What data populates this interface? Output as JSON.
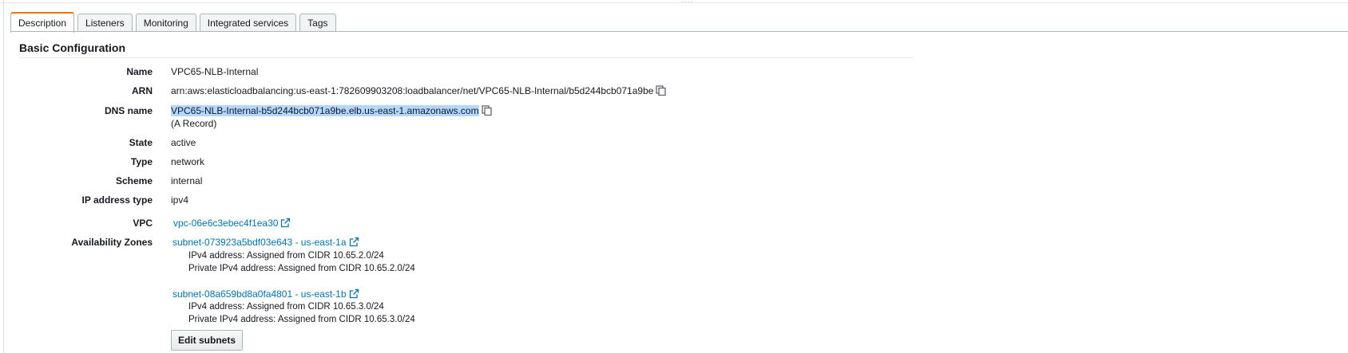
{
  "tabs": [
    {
      "label": "Description",
      "active": true
    },
    {
      "label": "Listeners",
      "active": false
    },
    {
      "label": "Monitoring",
      "active": false
    },
    {
      "label": "Integrated services",
      "active": false
    },
    {
      "label": "Tags",
      "active": false
    }
  ],
  "section_title": "Basic Configuration",
  "fields": {
    "name": {
      "label": "Name",
      "value": "VPC65-NLB-Internal"
    },
    "arn": {
      "label": "ARN",
      "value": "arn:aws:elasticloadbalancing:us-east-1:782609903208:loadbalancer/net/VPC65-NLB-Internal/b5d244bcb071a9be"
    },
    "dns": {
      "label": "DNS name",
      "value": "VPC65-NLB-Internal-b5d244bcb071a9be.elb.us-east-1.amazonaws.com",
      "note": "(A Record)"
    },
    "state": {
      "label": "State",
      "value": "active"
    },
    "type": {
      "label": "Type",
      "value": "network"
    },
    "scheme": {
      "label": "Scheme",
      "value": "internal"
    },
    "ip_type": {
      "label": "IP address type",
      "value": "ipv4"
    },
    "vpc": {
      "label": "VPC",
      "value": "vpc-06e6c3ebec4f1ea30"
    },
    "az": {
      "label": "Availability Zones",
      "subnets": [
        {
          "link": "subnet-073923a5bdf03e643 - us-east-1a",
          "ipv4": "IPv4 address: Assigned from CIDR 10.65.2.0/24",
          "private": "Private IPv4 address: Assigned from CIDR 10.65.2.0/24"
        },
        {
          "link": "subnet-08a659bd8a0fa4801 - us-east-1b",
          "ipv4": "IPv4 address: Assigned from CIDR 10.65.3.0/24",
          "private": "Private IPv4 address: Assigned from CIDR 10.65.3.0/24"
        }
      ]
    }
  },
  "edit_subnets_label": "Edit subnets",
  "colors": {
    "accent": "#ec7211",
    "link": "#0073bb",
    "selection": "#b3d7ff"
  },
  "icons": {
    "copy": "copy-icon",
    "external": "external-link-icon"
  }
}
